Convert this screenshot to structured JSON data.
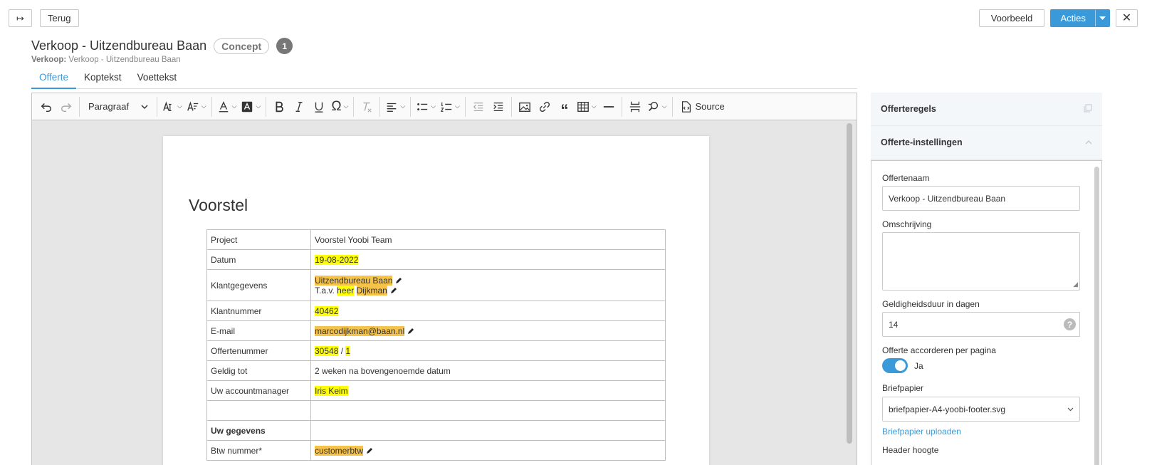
{
  "topbar": {
    "back_label": "Terug",
    "preview_label": "Voorbeeld",
    "actions_label": "Acties",
    "close_glyph": "✕",
    "expand_glyph": "↦"
  },
  "header": {
    "title": "Verkoop - Uitzendbureau Baan",
    "status": "Concept",
    "version": "1",
    "subtitle_label": "Verkoop:",
    "subtitle_value": "Verkoop - Uitzendbureau Baan"
  },
  "tabs": [
    {
      "label": "Offerte",
      "active": true
    },
    {
      "label": "Koptekst",
      "active": false
    },
    {
      "label": "Voettekst",
      "active": false
    }
  ],
  "toolbar": {
    "paragraph_label": "Paragraaf",
    "source_label": "Source"
  },
  "document": {
    "heading": "Voorstel",
    "rows": {
      "project": {
        "label": "Project",
        "value": "Voorstel Yoobi Team"
      },
      "datum": {
        "label": "Datum",
        "value": "19-08-2022"
      },
      "klant": {
        "label": "Klantgegevens",
        "company": "Uitzendbureau Baan",
        "attn_prefix": "T.a.v.",
        "attn_title": "heer",
        "attn_name": "Dijkman"
      },
      "klantnummer": {
        "label": "Klantnummer",
        "value": "40462"
      },
      "email": {
        "label": "E-mail",
        "value": "marcodijkman@baan.nl"
      },
      "offertenummer": {
        "label": "Offertenummer",
        "value1": "30548",
        "sep": " / ",
        "value2": "1"
      },
      "geldig": {
        "label": "Geldig tot",
        "value": "2 weken na bovengenoemde datum"
      },
      "manager": {
        "label": "Uw accountmanager",
        "value": "Iris Keim"
      },
      "gegevens": {
        "label": "Uw gegevens"
      },
      "btw": {
        "label": "Btw nummer*",
        "value": "customerbtw"
      }
    }
  },
  "panel": {
    "section1": "Offerteregels",
    "section2": "Offerte-instellingen",
    "fields": {
      "name_label": "Offertenaam",
      "name_value": "Verkoop - Uitzendbureau Baan",
      "desc_label": "Omschrijving",
      "valid_label": "Geldigheidsduur in dagen",
      "valid_value": "14",
      "approve_label": "Offerte accorderen per pagina",
      "approve_value": "Ja",
      "paper_label": "Briefpapier",
      "paper_value": "briefpapier-A4-yoobi-footer.svg",
      "paper_upload": "Briefpapier uploaden",
      "header_height_label": "Header hoogte"
    }
  },
  "colors": {
    "accent": "#3a9ad9",
    "highlight_yellow": "#ffff00",
    "highlight_orange": "#f5c24a"
  }
}
